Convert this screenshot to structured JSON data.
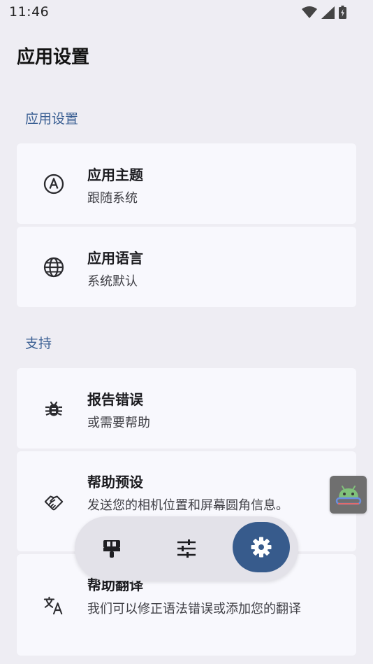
{
  "status_bar": {
    "time": "11:46",
    "icons": [
      "wifi-icon",
      "signal-icon",
      "battery-charging-icon"
    ]
  },
  "page": {
    "title": "应用设置"
  },
  "sections": [
    {
      "title": "应用设置",
      "items": [
        {
          "icon": "theme-a-icon",
          "title": "应用主题",
          "subtitle": "跟随系统"
        },
        {
          "icon": "globe-icon",
          "title": "应用语言",
          "subtitle": "系统默认"
        }
      ]
    },
    {
      "title": "支持",
      "items": [
        {
          "icon": "bug-icon",
          "title": "报告错误",
          "subtitle": "或需要帮助"
        },
        {
          "icon": "handshake-icon",
          "title": "帮助预设",
          "subtitle": "发送您的相机位置和屏幕圆角信息。"
        },
        {
          "icon": "translate-icon",
          "title": "帮助翻译",
          "subtitle": "我们可以修正语法错误或添加您的翻译"
        }
      ]
    }
  ],
  "bottom_nav": {
    "items": [
      {
        "icon": "paint-brush-icon",
        "active": false
      },
      {
        "icon": "tune-sliders-icon",
        "active": false
      },
      {
        "icon": "settings-gear-icon",
        "active": true
      }
    ],
    "active_color": "#375b8c"
  },
  "floating_bubble": {
    "icon": "android-icon"
  },
  "colors": {
    "background": "#eeedf3",
    "card": "#f8f8fd",
    "section_title": "#3a5f93",
    "accent": "#375b8c"
  }
}
